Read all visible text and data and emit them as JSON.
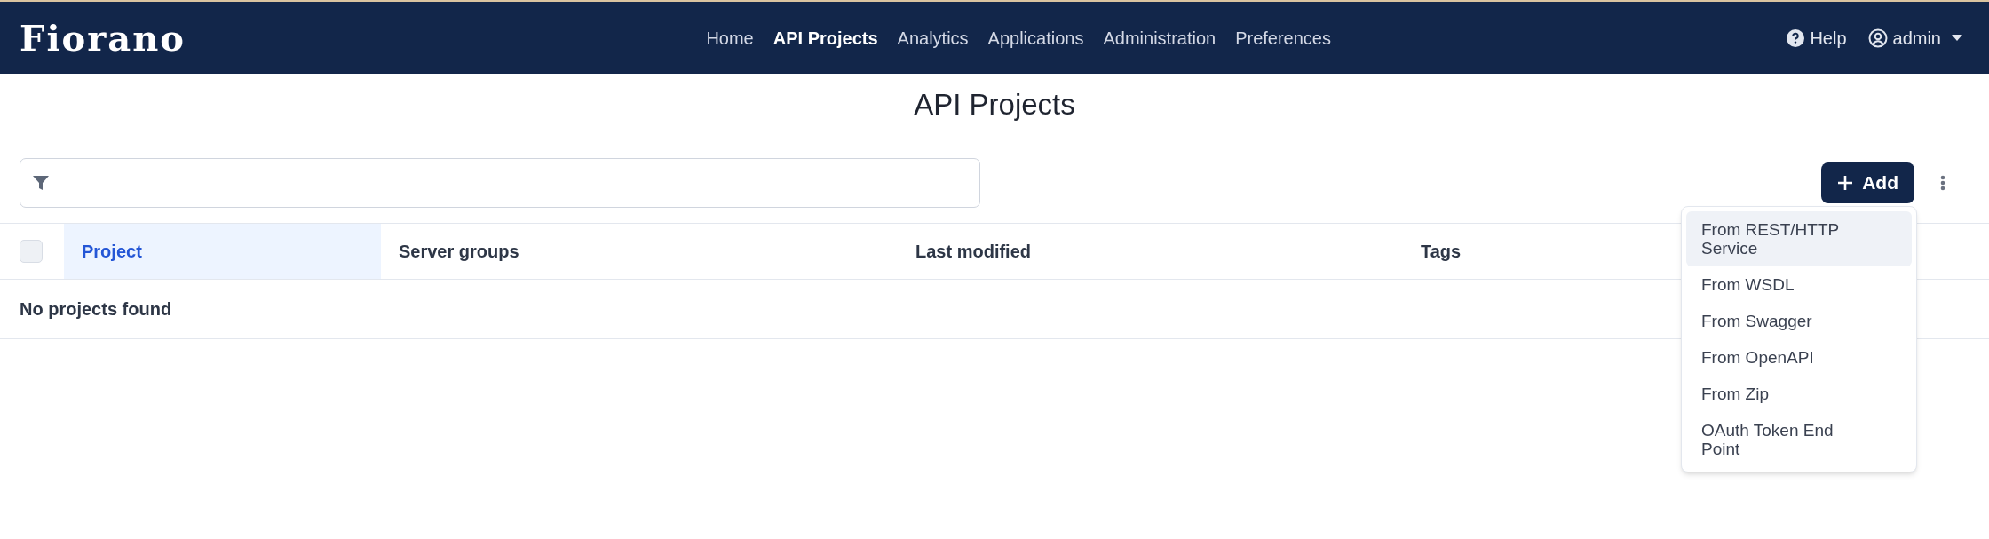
{
  "navbar": {
    "logo": "Fiorano",
    "links": [
      {
        "label": "Home",
        "selected": false
      },
      {
        "label": "API Projects",
        "selected": true
      },
      {
        "label": "Analytics",
        "selected": false
      },
      {
        "label": "Applications",
        "selected": false
      },
      {
        "label": "Administration",
        "selected": false
      },
      {
        "label": "Preferences",
        "selected": false
      }
    ],
    "help": "Help",
    "user": "admin"
  },
  "page_title": "API Projects",
  "toolbar": {
    "add_button": "Add"
  },
  "table": {
    "select_all_checked": false,
    "columns": [
      {
        "label": "Project",
        "selected": true
      },
      {
        "label": "Server groups",
        "selected": false
      },
      {
        "label": "Last modified",
        "selected": false
      },
      {
        "label": "Tags",
        "selected": false
      }
    ],
    "empty_message": "No projects found"
  },
  "add_menu": {
    "items": [
      {
        "label": "From REST/HTTP Service",
        "selected": true
      },
      {
        "label": "From WSDL",
        "selected": false
      },
      {
        "label": "From Swagger",
        "selected": false
      },
      {
        "label": "From OpenAPI",
        "selected": false
      },
      {
        "label": "From Zip",
        "selected": false
      },
      {
        "label": "OAuth Token End Point",
        "selected": false
      }
    ]
  }
}
